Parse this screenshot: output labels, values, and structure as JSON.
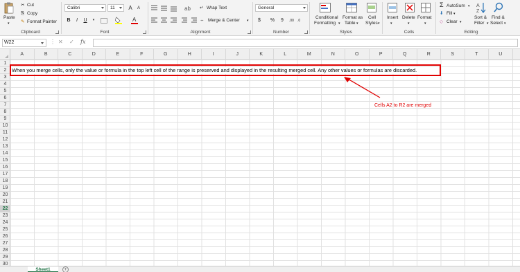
{
  "ribbon": {
    "clipboard": {
      "paste": "Paste",
      "cut": "Cut",
      "copy": "Copy",
      "format_painter": "Format Painter",
      "label": "Clipboard"
    },
    "font": {
      "font_name": "Calibri",
      "font_size": "11",
      "bold": "B",
      "italic": "I",
      "underline": "U",
      "grow": "A",
      "shrink": "A",
      "label": "Font"
    },
    "alignment": {
      "wrap_text": "Wrap Text",
      "merge_center": "Merge & Center",
      "label": "Alignment"
    },
    "number": {
      "format": "General",
      "currency": "$",
      "percent": "%",
      "comma": "9",
      "label": "Number"
    },
    "styles": {
      "conditional_formatting": [
        "Conditional",
        "Formatting"
      ],
      "format_as_table": [
        "Format as",
        "Table"
      ],
      "cell_styles": [
        "Cell",
        "Styles"
      ],
      "label": "Styles"
    },
    "cells": {
      "insert": "Insert",
      "delete": "Delete",
      "format": "Format",
      "label": "Cells"
    },
    "editing": {
      "autosum": "AutoSum",
      "fill": "Fill",
      "clear": "Clear",
      "sort_filter": [
        "Sort &",
        "Filter"
      ],
      "find_select": [
        "Find &",
        "Select"
      ],
      "label": "Editing"
    }
  },
  "formula_bar": {
    "name_box": "W22",
    "fx": "fx",
    "value": ""
  },
  "columns": [
    "A",
    "B",
    "C",
    "D",
    "E",
    "F",
    "G",
    "H",
    "I",
    "J",
    "K",
    "L",
    "M",
    "N",
    "O",
    "P",
    "Q",
    "R",
    "S",
    "T",
    "U"
  ],
  "rows": [
    "1",
    "2",
    "3",
    "4",
    "5",
    "6",
    "7",
    "8",
    "9",
    "10",
    "11",
    "12",
    "13",
    "14",
    "15",
    "16",
    "17",
    "18",
    "19",
    "20",
    "21",
    "22",
    "23",
    "24",
    "25",
    "26",
    "27",
    "28",
    "29",
    "30"
  ],
  "selected_row": "22",
  "merged_cell_text": "When you merge cells, only the value or formula in the top left cell of the range is preserved and displayed in the resulting merged cell. Any other values or formulas are discarded.",
  "annotation": "Cells A2 to R2 are merged",
  "sheet_tab": "Sheet1",
  "colors": {
    "accent": "#217346",
    "annotation": "#e00000"
  }
}
